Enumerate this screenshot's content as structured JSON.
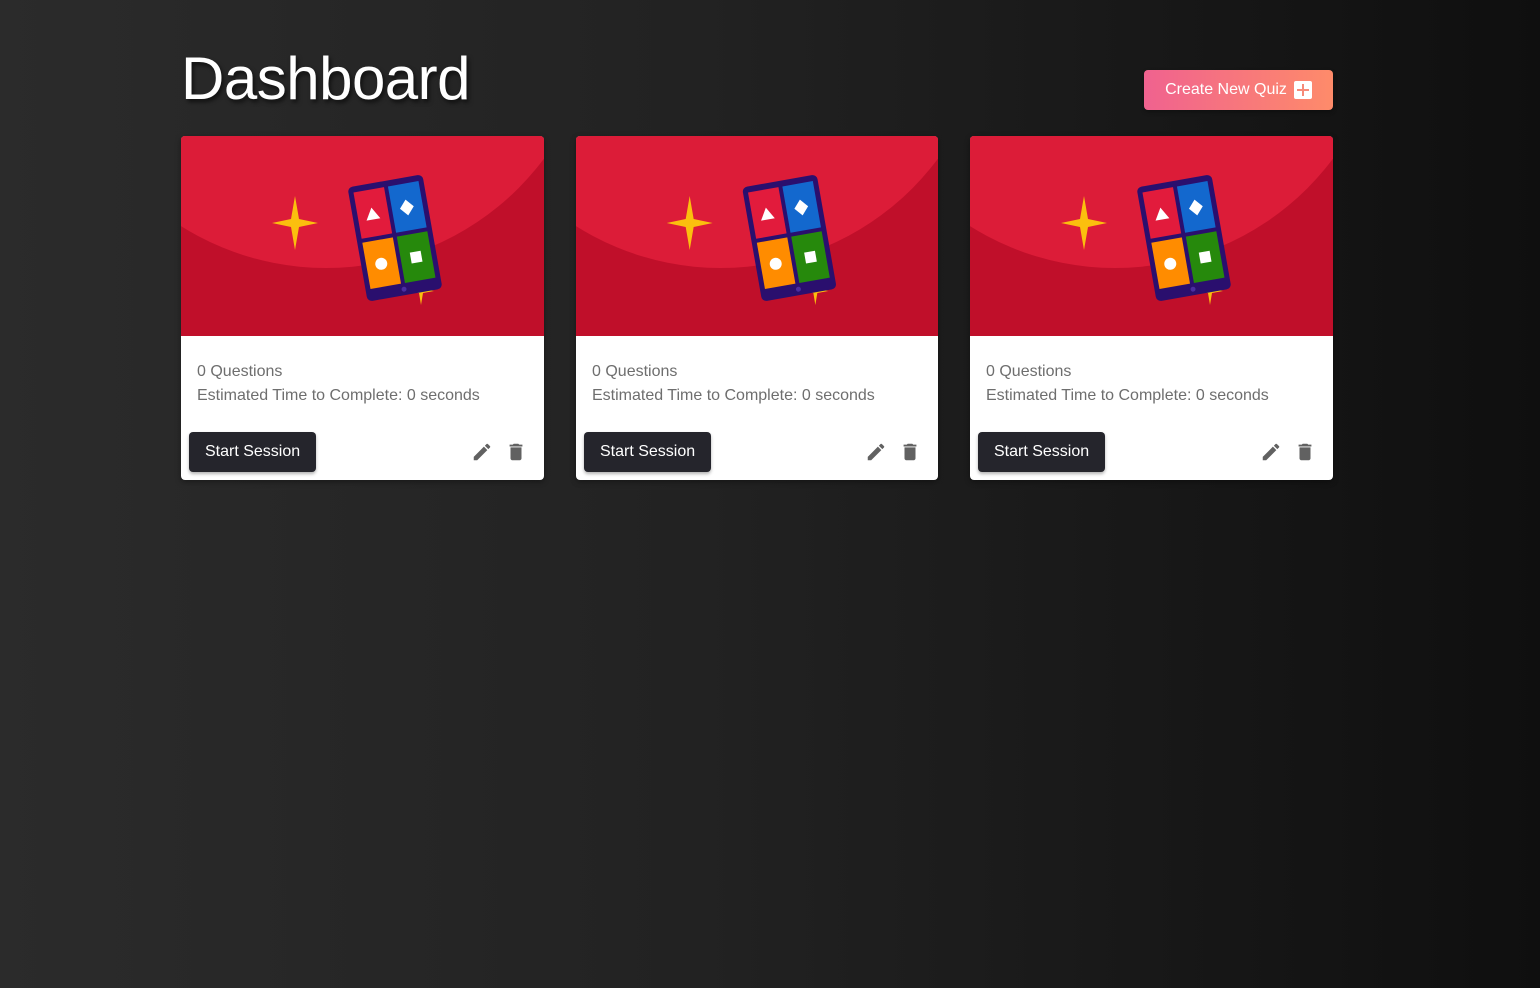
{
  "page": {
    "title": "Dashboard",
    "create_button_label": "Create New Quiz",
    "create_button_icon": "plus-box-icon"
  },
  "colors": {
    "card_banner": "#c00f2a",
    "card_banner_light": "#dc1c38",
    "primary_button": "#25252c",
    "create_gradient_start": "#f0628f",
    "create_gradient_end": "#fe8b6a"
  },
  "quizzes": [
    {
      "questions": "0 Questions",
      "estimated_time": "Estimated Time to Complete: 0 seconds",
      "start_label": "Start Session",
      "edit_icon": "pencil-icon",
      "delete_icon": "trash-icon"
    },
    {
      "questions": "0 Questions",
      "estimated_time": "Estimated Time to Complete: 0 seconds",
      "start_label": "Start Session",
      "edit_icon": "pencil-icon",
      "delete_icon": "trash-icon"
    },
    {
      "questions": "0 Questions",
      "estimated_time": "Estimated Time to Complete: 0 seconds",
      "start_label": "Start Session",
      "edit_icon": "pencil-icon",
      "delete_icon": "trash-icon"
    }
  ]
}
